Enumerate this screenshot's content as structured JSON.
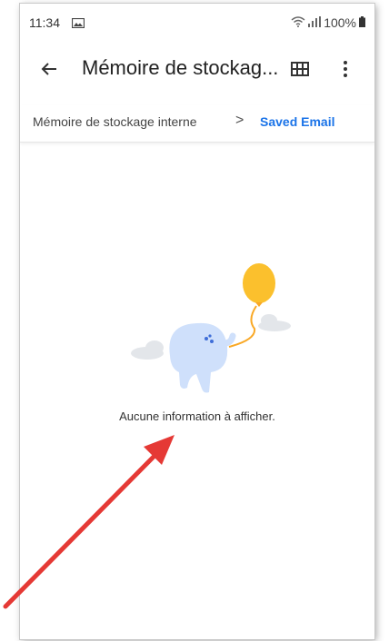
{
  "status_bar": {
    "time": "11:34",
    "battery": "100%"
  },
  "app_bar": {
    "title": "Mémoire de stockag...",
    "icons": [
      "back-arrow-icon",
      "grid-view-icon",
      "more-vert-icon"
    ]
  },
  "breadcrumb": {
    "items": [
      "Mémoire de stockage interne",
      "Saved Email"
    ],
    "separator": ">"
  },
  "empty_state": {
    "message": "Aucune information à afficher."
  },
  "colors": {
    "accent": "#1a73e8",
    "balloon": "#fbc02d",
    "creature": "#cfe0fb",
    "annotation": "#e53935"
  }
}
